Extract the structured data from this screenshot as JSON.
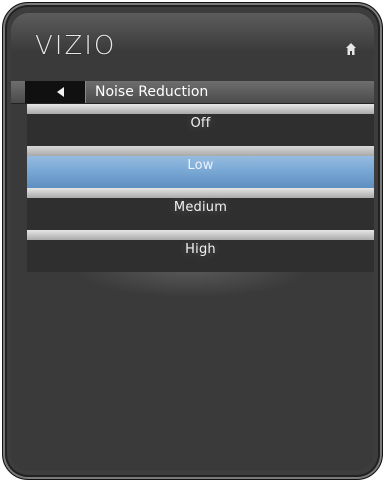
{
  "header": {
    "logo_text": "VIZIO",
    "home_icon": "home-icon"
  },
  "menu": {
    "back_icon": "back-arrow-icon",
    "title": "Noise Reduction",
    "options": [
      {
        "label": "Off",
        "selected": false
      },
      {
        "label": "Low",
        "selected": true
      },
      {
        "label": "Medium",
        "selected": false
      },
      {
        "label": "High",
        "selected": false
      }
    ]
  },
  "colors": {
    "selected_highlight": "#78a7d4",
    "panel_bg": "#3a3a3a"
  }
}
